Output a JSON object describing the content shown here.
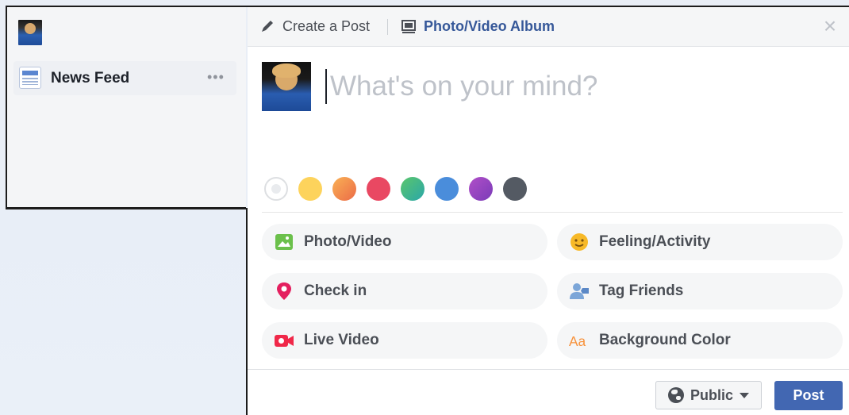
{
  "sidebar": {
    "news_feed_label": "News Feed",
    "more": "•••"
  },
  "composer": {
    "tabs": {
      "create_post": "Create a Post",
      "photo_album": "Photo/Video Album"
    },
    "close": "×",
    "placeholder": "What's on your mind?",
    "background_colors": [
      "#ffffff",
      "#fdd35c",
      "#f48a4a",
      "#e94862",
      "#36b8a0",
      "#4a8ddb",
      "#9145c2",
      "#545a63"
    ],
    "actions": [
      {
        "label": "Photo/Video",
        "icon": "photo-icon"
      },
      {
        "label": "Feeling/Activity",
        "icon": "smiley-icon"
      },
      {
        "label": "Check in",
        "icon": "location-pin-icon"
      },
      {
        "label": "Tag Friends",
        "icon": "tag-friends-icon"
      },
      {
        "label": "Live Video",
        "icon": "video-camera-icon"
      },
      {
        "label": "Background Color",
        "icon": "aa-icon"
      }
    ],
    "footer": {
      "privacy": "Public",
      "post": "Post"
    }
  },
  "colors": {
    "brand_blue": "#4267b2",
    "link_blue": "#365899"
  }
}
